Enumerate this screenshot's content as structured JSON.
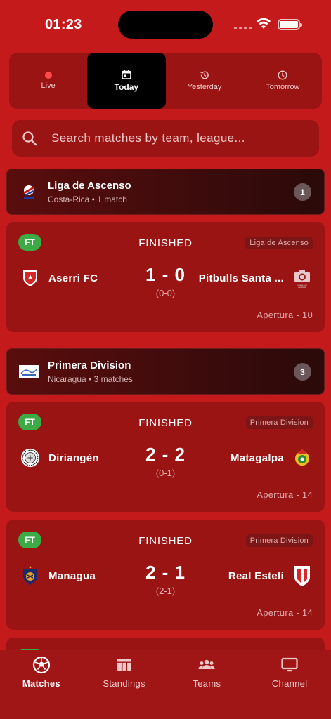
{
  "status_bar": {
    "time": "01:23"
  },
  "tabs": [
    {
      "label": "Live",
      "icon": "live-dot-icon"
    },
    {
      "label": "Today",
      "icon": "calendar-icon"
    },
    {
      "label": "Yesterday",
      "icon": "history-icon"
    },
    {
      "label": "Tomorrow",
      "icon": "clock-icon"
    }
  ],
  "search": {
    "placeholder": "Search matches by team, league..."
  },
  "leagues": [
    {
      "name": "Liga de Ascenso",
      "subtitle": "Costa-Rica • 1 match",
      "count": "1",
      "matches": [
        {
          "status_badge": "FT",
          "status": "FINISHED",
          "league_badge": "Liga de Ascenso",
          "home": "Aserri FC",
          "away": "Pitbulls Santa ...",
          "score": "1 - 0",
          "halftime": "(0-0)",
          "round": "Apertura - 10",
          "away_logo_text": "image not available"
        }
      ]
    },
    {
      "name": "Primera Division",
      "subtitle": "Nicaragua • 3 matches",
      "count": "3",
      "matches": [
        {
          "status_badge": "FT",
          "status": "FINISHED",
          "league_badge": "Primera Division",
          "home": "Diriangén",
          "away": "Matagalpa",
          "score": "2 - 2",
          "halftime": "(0-1)",
          "round": "Apertura - 14"
        },
        {
          "status_badge": "FT",
          "status": "FINISHED",
          "league_badge": "Primera Division",
          "home": "Managua",
          "away": "Real Estelí",
          "score": "2 - 1",
          "halftime": "(2-1)",
          "round": "Apertura - 14"
        }
      ]
    }
  ],
  "bottom_nav": [
    {
      "label": "Matches",
      "icon": "soccer-ball-icon"
    },
    {
      "label": "Standings",
      "icon": "table-icon"
    },
    {
      "label": "Teams",
      "icon": "people-icon"
    },
    {
      "label": "Channel",
      "icon": "tv-icon"
    }
  ],
  "colors": {
    "background": "#c41a1c",
    "card": "#9b1414",
    "ft_badge": "#3cab46",
    "active_tab": "#000000"
  }
}
